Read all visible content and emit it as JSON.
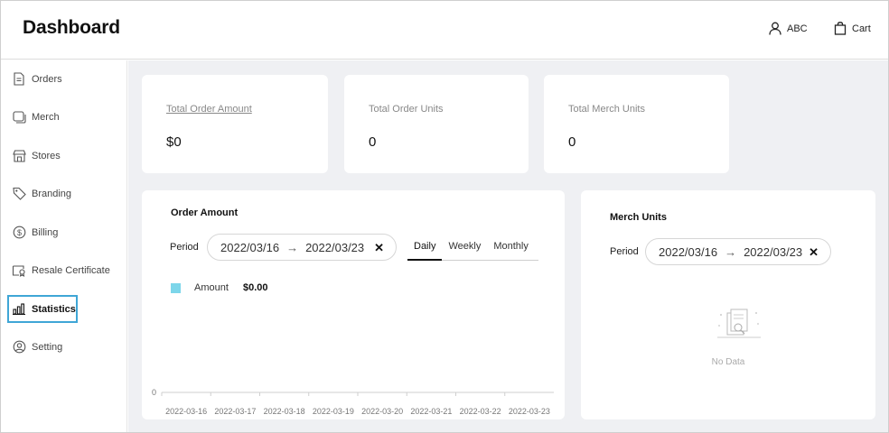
{
  "header": {
    "title": "Dashboard",
    "user_label": "ABC",
    "cart_label": "Cart"
  },
  "sidebar": {
    "items": [
      {
        "label": "Orders",
        "icon": "document-icon"
      },
      {
        "label": "Merch",
        "icon": "merch-icon"
      },
      {
        "label": "Stores",
        "icon": "store-icon"
      },
      {
        "label": "Branding",
        "icon": "tag-icon"
      },
      {
        "label": "Billing",
        "icon": "dollar-icon"
      },
      {
        "label": "Resale Certificate",
        "icon": "certificate-icon"
      },
      {
        "label": "Statistics",
        "icon": "bar-chart-icon",
        "active": true
      },
      {
        "label": "Setting",
        "icon": "user-circle-icon"
      }
    ]
  },
  "stats": [
    {
      "label": "Total Order Amount",
      "value": "$0"
    },
    {
      "label": "Total Order Units",
      "value": "0"
    },
    {
      "label": "Total Merch Units",
      "value": "0"
    }
  ],
  "order_amount": {
    "title": "Order Amount",
    "period_label": "Period",
    "date_start": "2022/03/16",
    "date_end": "2022/03/23",
    "tabs": [
      "Daily",
      "Weekly",
      "Monthly"
    ],
    "active_tab": "Daily",
    "legend": {
      "name": "Amount",
      "value": "$0.00",
      "color": "#7dd6ea"
    }
  },
  "merch_units": {
    "title": "Merch Units",
    "period_label": "Period",
    "date_start": "2022/03/16",
    "date_end": "2022/03/23",
    "empty_text": "No Data"
  },
  "chart_data": {
    "type": "line",
    "x": [
      "2022-03-16",
      "2022-03-17",
      "2022-03-18",
      "2022-03-19",
      "2022-03-20",
      "2022-03-21",
      "2022-03-22",
      "2022-03-23"
    ],
    "series": [
      {
        "name": "Amount",
        "values": [
          0,
          0,
          0,
          0,
          0,
          0,
          0,
          0
        ]
      }
    ],
    "y_ticks": [
      "0"
    ],
    "ylim": [
      0,
      1
    ],
    "grid": false,
    "legend": "top-left",
    "color": "#7dd6ea"
  }
}
